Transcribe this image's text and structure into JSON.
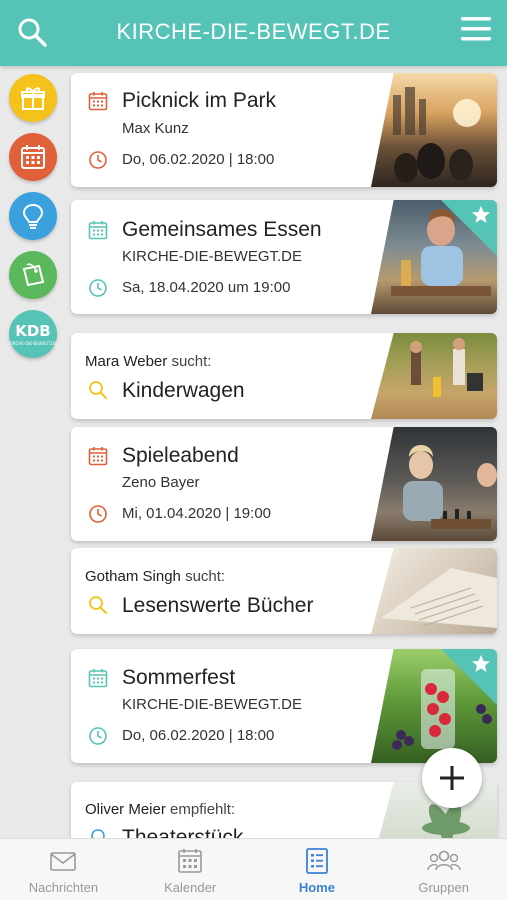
{
  "header": {
    "title": "KIRCHE-DIE-BEWEGT.DE"
  },
  "cards": [
    {
      "title": "Picknick im Park",
      "subtitle": "Max Kunz",
      "date": "Do, 06.02.2020 | 18:00"
    },
    {
      "title": "Gemeinsames Essen",
      "subtitle": "KIRCHE-DIE-BEWEGT.DE",
      "date": "Sa, 18.04.2020 um 19:00",
      "starred": true
    },
    {
      "who": "Mara Weber",
      "verb": "sucht:",
      "title": "Kinderwagen"
    },
    {
      "title": "Spieleabend",
      "subtitle": "Zeno Bayer",
      "date": "Mi, 01.04.2020 | 19:00"
    },
    {
      "who": "Gotham Singh",
      "verb": "sucht:",
      "title": "Lesenswerte Bücher"
    },
    {
      "title": "Sommerfest",
      "subtitle": "KIRCHE-DIE-BEWEGT.DE",
      "date": "Do, 06.02.2020 | 18:00",
      "starred": true
    },
    {
      "who": "Oliver Meier",
      "verb": "empfiehlt:",
      "title": "Theaterstück"
    }
  ],
  "side": {
    "kdb_text": "KDB",
    "kdb_small": "KIRCHE-DIE-BEWEGT.DE"
  },
  "nav": [
    {
      "label": "Nachrichten"
    },
    {
      "label": "Kalender"
    },
    {
      "label": "Home"
    },
    {
      "label": "Gruppen"
    }
  ],
  "colors": {
    "teal": "#55c3b5",
    "orange": "#e0603a",
    "yellow": "#f4c21b",
    "blue": "#3b82d6",
    "green": "#5cb85c",
    "light_blue": "#3aa0de"
  }
}
